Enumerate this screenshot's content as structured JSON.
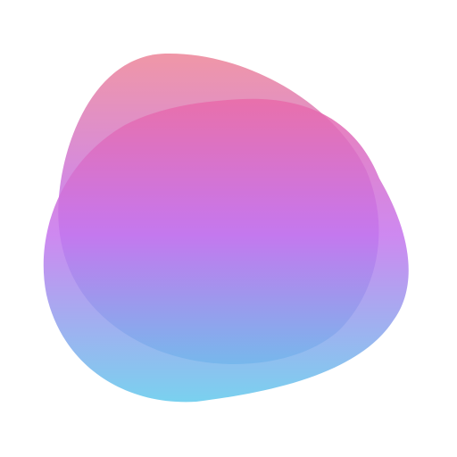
{
  "icon": {
    "name": "gradient-blob-logo-icon",
    "layers": [
      {
        "name": "upper-blob",
        "colors": [
          "#ED8497",
          "#C572EA",
          "#55B7E8"
        ],
        "opacity": 0.85
      },
      {
        "name": "lower-blob",
        "colors": [
          "#E96AA8",
          "#C574EE",
          "#62C9EC"
        ],
        "opacity": 0.85
      }
    ],
    "background": "#FFFFFF"
  }
}
